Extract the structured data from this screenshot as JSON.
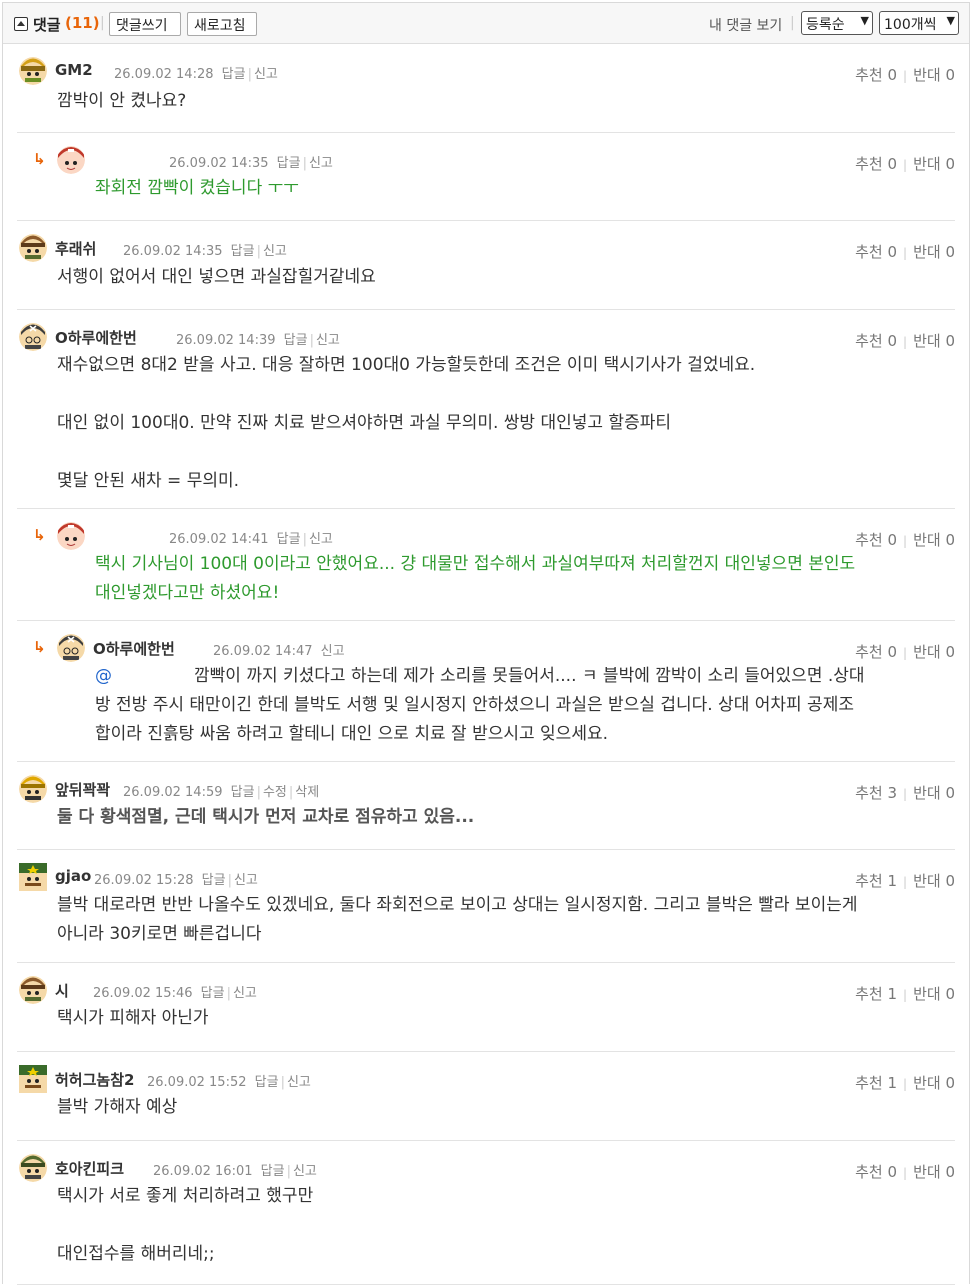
{
  "header": {
    "title": "댓글",
    "count": "(11)",
    "write_label": "댓글쓰기",
    "refresh_label": "새로고침",
    "my_comments_label": "내 댓글 보기",
    "order_label": "등록순",
    "per_page_label": "100개씩"
  },
  "labels": {
    "reply": "답글",
    "report": "신고",
    "edit": "수정",
    "delete": "삭제",
    "up": "추천",
    "down": "반대"
  },
  "comments": [
    {
      "nick": "GM2",
      "date": "26.09.02 14:28",
      "up": "0",
      "down": "0",
      "text": "깜박이 안 켰나요?"
    },
    {
      "nick": "",
      "date": "26.09.02 14:35",
      "up": "0",
      "down": "0",
      "text": "좌회전 깜빡이 켰습니다 ㅜㅜ"
    },
    {
      "nick": "후래쉬",
      "date": "26.09.02 14:35",
      "up": "0",
      "down": "0",
      "text": "서행이 없어서 대인 넣으면 과실잡힐거같네요"
    },
    {
      "nick": "O하루에한번",
      "date": "26.09.02 14:39",
      "up": "0",
      "down": "0",
      "line1": "재수없으면 8대2 받을 사고. 대응 잘하면 100대0 가능할듯한데 조건은 이미 택시기사가 걸었네요.",
      "line2": "대인 없이 100대0. 만약 진짜 치료 받으셔야하면 과실 무의미. 쌍방 대인넣고 할증파티",
      "line3": "몇달 안된 새차 = 무의미."
    },
    {
      "nick": "",
      "date": "26.09.02 14:41",
      "up": "0",
      "down": "0",
      "line1": "택시 기사님이 100대 0이라고 안했어요... 걍 대물만 접수해서 과실여부따져 처리할껀지 대인넣으면 본인도",
      "line2": "대인넣겠다고만 하셨어요!"
    },
    {
      "nick": "O하루에한번",
      "date": "26.09.02 14:47",
      "up": "0",
      "down": "0",
      "mention": "@",
      "line1": "깜빡이 까지 키셨다고 하는데 제가 소리를 못들어서.... ㅋ 블박에 깜박이 소리 들어있으면 .상대",
      "line2": "방 전방 주시 태만이긴 한데 블박도 서행 및 일시정지 안하셨으니 과실은 받으실 겁니다. 상대 어차피 공제조",
      "line3": "합이라 진흙탕 싸움 하려고 할테니 대인 으로 치료 잘 받으시고 잊으세요."
    },
    {
      "nick": "앞뒤꽉꽉",
      "date": "26.09.02 14:59",
      "up": "3",
      "down": "0",
      "text": "둘 다 황색점멸, 근데 택시가 먼저 교차로 점유하고 있음..."
    },
    {
      "nick": "gjao",
      "date": "26.09.02 15:28",
      "up": "1",
      "down": "0",
      "line1": "블박 대로라면 반반 나올수도 있겠네요, 둘다 좌회전으로 보이고 상대는 일시정지함. 그리고 블박은 빨라 보이는게",
      "line2": "아니라 30키로면 빠른겁니다"
    },
    {
      "nick": "시",
      "date": "26.09.02 15:46",
      "up": "1",
      "down": "0",
      "text": "택시가 피해자 아닌가"
    },
    {
      "nick": "허허그놈참2",
      "date": "26.09.02 15:52",
      "up": "1",
      "down": "0",
      "text": "블박 가해자 예상"
    },
    {
      "nick": "호아킨피크",
      "date": "26.09.02 16:01",
      "up": "0",
      "down": "0",
      "line1": "택시가 서로 좋게 처리하려고 했구만",
      "line2": "대인접수를 해버리네;;"
    }
  ],
  "colors": {
    "accent": "#e8650a",
    "reply_text": "#2e9a2e",
    "mention": "#2266cc"
  }
}
